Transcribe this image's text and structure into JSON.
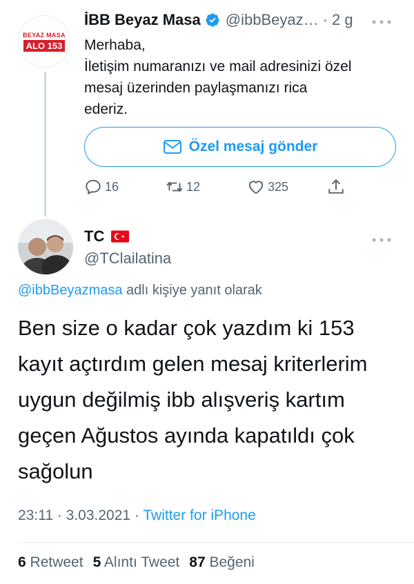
{
  "reply_tweet": {
    "avatar_logo": {
      "top": "BEYAZ MASA",
      "bottom": "ALO 153"
    },
    "display_name": "İBB Beyaz Masa",
    "handle": "@ibbBeyaz…",
    "time": "· 2 g",
    "text_lines": [
      "Merhaba,",
      "İletişim numaranızı ve mail adresinizi özel",
      "mesaj üzerinden paylaşmanızı rica",
      "ederiz."
    ],
    "dm_button_label": "Özel mesaj gönder",
    "actions": {
      "replies": "16",
      "retweets": "12",
      "likes": "325"
    },
    "icons": [
      "verified-badge-icon",
      "more-icon",
      "mail-icon",
      "reply-icon",
      "retweet-icon",
      "like-icon",
      "share-icon"
    ]
  },
  "main_tweet": {
    "display_name": "TC",
    "handle": "@TClailatina",
    "replying_to": {
      "mention": "@ibbBeyazmasa",
      "suffix": " adlı kişiye yanıt olarak"
    },
    "text_lines": [
      "Ben size o kadar çok yazdım ki 153",
      "kayıt açtırdım gelen mesaj kriterlerim",
      "uygun değilmiş ibb alışveriş kartım",
      "geçen Ağustos ayında kapatıldı çok",
      "sağolun"
    ],
    "timestamp": "23:11 · 3.03.2021 · ",
    "source": "Twitter for iPhone",
    "stats": {
      "retweets_count": "6",
      "retweets_label": " Retweet",
      "quotes_count": "5",
      "quotes_label": " Alıntı Tweet",
      "likes_count": "87",
      "likes_label": " Beğeni"
    },
    "icons": [
      "turkey-flag-icon",
      "more-icon"
    ]
  },
  "colors": {
    "accent": "#1d9bf0",
    "secondary_text": "#536471",
    "primary_text": "#0f1419",
    "brand_red": "#d4202b"
  }
}
